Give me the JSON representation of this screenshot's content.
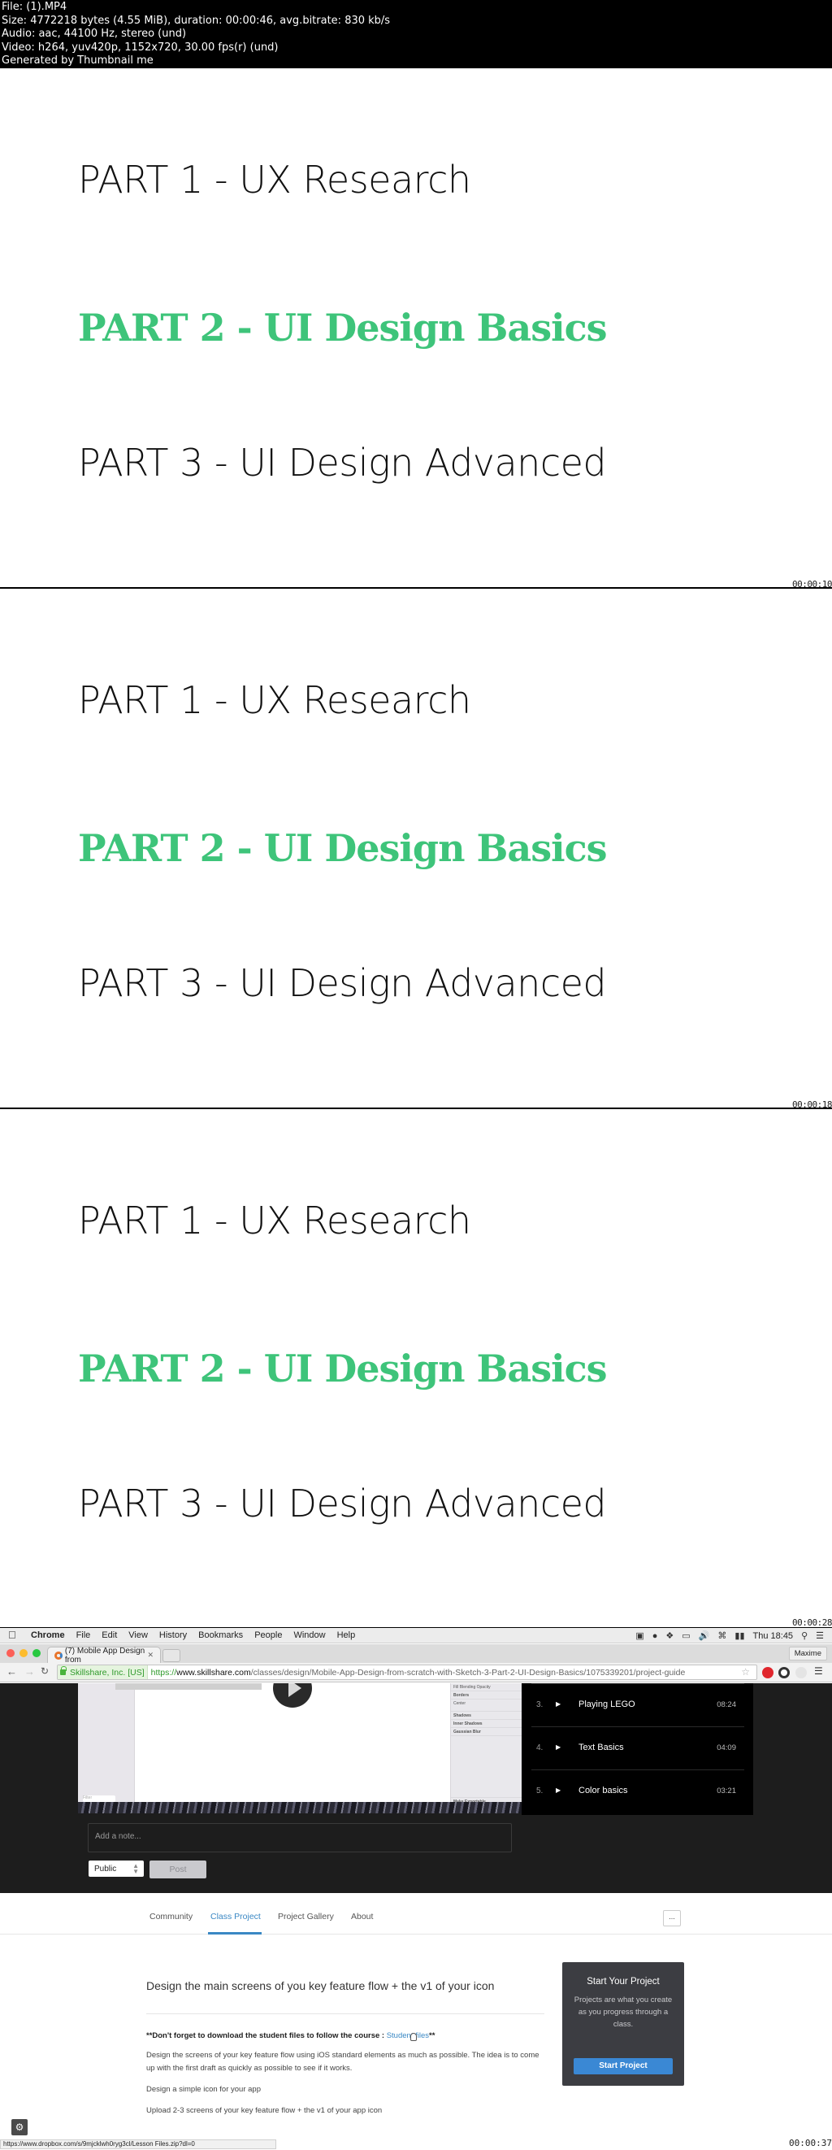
{
  "file_info": {
    "lines": [
      "File:  (1).MP4",
      "Size: 4772218 bytes (4.55 MiB), duration: 00:00:46, avg.bitrate: 830 kb/s",
      "Audio: aac, 44100 Hz, stereo (und)",
      "Video: h264, yuv420p, 1152x720, 30.00 fps(r) (und)",
      "Generated by Thumbnail me"
    ]
  },
  "frames": [
    {
      "timestamp": "00:00:10",
      "slide": {
        "part1": "PART 1 - UX Research",
        "part2": "PART 2 - UI Design Basics",
        "part3": "PART 3 - UI Design Advanced"
      }
    },
    {
      "timestamp": "00:00:18",
      "slide": {
        "part1": "PART 1 - UX Research",
        "part2": "PART 2 - UI Design Basics",
        "part3": "PART 3 - UI Design Advanced"
      }
    },
    {
      "timestamp": "00:00:28",
      "slide": {
        "part1": "PART 1 - UX Research",
        "part2": "PART 2 - UI Design Basics",
        "part3": "PART 3 - UI Design Advanced"
      }
    },
    {
      "timestamp": "00:00:37"
    }
  ],
  "colors": {
    "highlight_green": "#3ec47a",
    "skillshare_blue": "#3a88c4",
    "card_bg": "#3c3d42"
  },
  "macos_menubar": {
    "app": "Chrome",
    "items": [
      "File",
      "Edit",
      "View",
      "History",
      "Bookmarks",
      "People",
      "Window",
      "Help"
    ],
    "clock": "Thu 18:45",
    "icons": [
      "screen-record-icon",
      "evernote-icon",
      "dropbox-icon",
      "airplay-icon",
      "volume-icon",
      "wifi-icon",
      "battery-icon",
      "spotlight-icon",
      "notification-center-icon"
    ]
  },
  "browser": {
    "tab_title": "(7) Mobile App Design from",
    "profile_name": "Maxime",
    "ev_label": "Skillshare, Inc. [US]",
    "url_scheme": "https://",
    "url_host": "www.skillshare.com",
    "url_path": "/classes/design/Mobile-App-Design-from-scratch-with-Sketch-3-Part-2-UI-Design-Basics/1075339201/project-guide",
    "status_url": "https://www.dropbox.com/s/9mjcklwh0ryg3cl/Lesson Files.zip?dl=0"
  },
  "sketch_panel": {
    "rows": [
      "Fill  Blending  Opacity",
      "Borders",
      "Center",
      "Shadows",
      "Inner Shadows",
      "Gaussian Blur",
      "Make Exportable"
    ],
    "filter_placeholder": "Filter"
  },
  "playlist": [
    {
      "number": "3.",
      "title": "Playing LEGO",
      "duration": "08:24"
    },
    {
      "number": "4.",
      "title": "Text Basics",
      "duration": "04:09"
    },
    {
      "number": "5.",
      "title": "Color basics",
      "duration": "03:21"
    }
  ],
  "note": {
    "placeholder": "Add a note...",
    "privacy_value": "Public",
    "post_label": "Post"
  },
  "class_tabs": [
    {
      "label": "Community",
      "active": false
    },
    {
      "label": "Class Project",
      "active": true
    },
    {
      "label": "Project Gallery",
      "active": false
    },
    {
      "label": "About",
      "active": false
    }
  ],
  "more_label": "...",
  "project": {
    "title": "Design the main screens of you key feature flow + the v1 of your icon",
    "reminder_prefix": "**Don't forget to download the student files to follow the course : ",
    "reminder_link": "Student files",
    "reminder_suffix": "**",
    "paragraphs": [
      "Design the screens of your key feature flow using iOS standard elements as much as possible. The idea is to come up with the first draft as quickly as possible to see if it works.",
      "Design a simple icon for your app",
      "Upload 2-3 screens of your key feature flow + the v1 of your app icon"
    ]
  },
  "start_card": {
    "title": "Start Your Project",
    "description": "Projects are what you create as you progress through a class.",
    "button": "Start Project"
  }
}
